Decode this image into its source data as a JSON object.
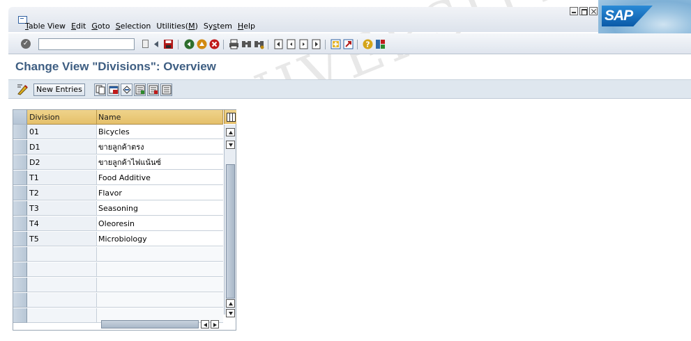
{
  "menubar": {
    "items": [
      {
        "label": "Table View",
        "mnemonic": "T",
        "rest": "able View"
      },
      {
        "label": "Edit",
        "mnemonic": "E",
        "rest": "dit"
      },
      {
        "label": "Goto",
        "mnemonic": "G",
        "rest": "oto"
      },
      {
        "label": "Selection",
        "mnemonic": "S",
        "rest": "election"
      },
      {
        "label": "Utilities(M)",
        "pre": "Utilities(",
        "mnemonic": "M",
        "post": ")"
      },
      {
        "label": "System",
        "pre": "Sy",
        "mnemonic": "s",
        "post": "tem"
      },
      {
        "label": "Help",
        "mnemonic": "H",
        "rest": "elp"
      }
    ],
    "logo_text": "SAP"
  },
  "toolbar": {
    "command_field_value": "",
    "icons": [
      "enter-icon",
      "save-icon",
      "back-icon",
      "exit-icon",
      "cancel-icon",
      "print-icon",
      "find-icon",
      "find-next-icon",
      "first-page-icon",
      "previous-page-icon",
      "next-page-icon",
      "last-page-icon",
      "create-session-icon",
      "shortcut-icon",
      "help-icon",
      "layout-icon"
    ]
  },
  "page": {
    "title": "Change View \"Divisions\": Overview"
  },
  "app_toolbar": {
    "new_entries_label": "New Entries"
  },
  "table": {
    "columns": [
      "Division",
      "Name"
    ],
    "rows": [
      {
        "division": "01",
        "name": "Bicycles"
      },
      {
        "division": "D1",
        "name": "ขายลูกค้าตรง"
      },
      {
        "division": "D2",
        "name": "ขายลูกค้าไฟแน้นซ์"
      },
      {
        "division": "T1",
        "name": "Food Additive"
      },
      {
        "division": "T2",
        "name": "Flavor"
      },
      {
        "division": "T3",
        "name": "Seasoning"
      },
      {
        "division": "T4",
        "name": "Oleoresin"
      },
      {
        "division": "T5",
        "name": "Microbiology"
      }
    ],
    "empty_rows": 5
  },
  "watermark": {
    "text_latin": "UNIVERSITY",
    "text_thai": "ริ้มหาวิทยาลัยเชียงใหม"
  }
}
